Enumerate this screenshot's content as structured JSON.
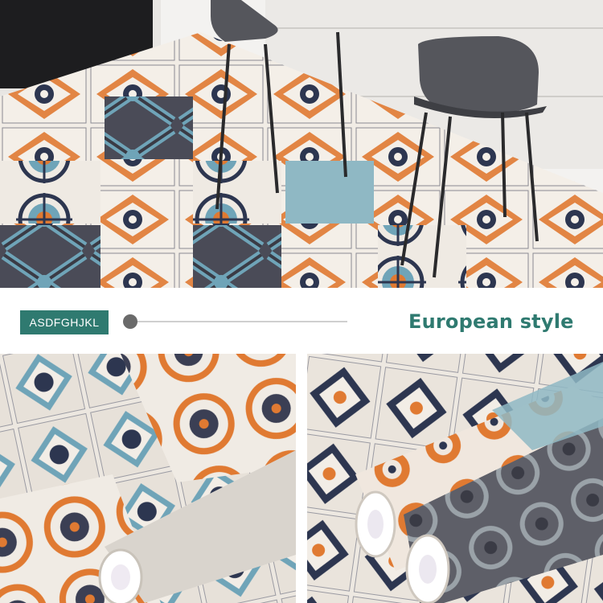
{
  "badge": {
    "label": "ASDFGHJKL"
  },
  "headline": {
    "text": "European style"
  },
  "colors": {
    "accent": "#2f7a70",
    "tile_orange": "#e07a32",
    "tile_blue": "#6fa4b8",
    "tile_navy": "#2d3650",
    "tile_gray": "#5c5c66",
    "tile_cream": "#f2ede6"
  },
  "slider": {
    "position_fraction": 0.0
  },
  "images": [
    {
      "name": "hero-kitchen-floor-photo",
      "depicts": "patterned tile floor with two gray bar stools"
    },
    {
      "name": "left-tile-closeup-photo",
      "depicts": "close-up of patterned tiles with rolled vinyl sheet"
    },
    {
      "name": "right-tile-rolls-photo",
      "depicts": "rolled sheets of patterned tile vinyl"
    }
  ]
}
